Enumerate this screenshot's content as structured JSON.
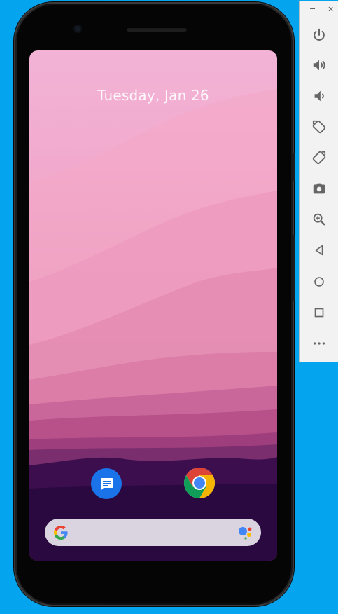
{
  "lockscreen": {
    "date": "Tuesday, Jan 26"
  },
  "home": {
    "apps": [
      {
        "name": "Messages",
        "icon": "messages-icon"
      },
      {
        "name": "Chrome",
        "icon": "chrome-icon"
      }
    ],
    "search_bar": {
      "icon_left": "google-g-icon",
      "icon_right": "assistant-icon"
    }
  },
  "emulator_toolbar": {
    "window_controls": {
      "minimize": "−",
      "close": "×"
    },
    "tools": [
      "power-icon",
      "volume-up-icon",
      "volume-down-icon",
      "rotate-left-icon",
      "rotate-right-icon",
      "screenshot-icon",
      "zoom-icon",
      "back-icon",
      "home-icon",
      "overview-icon",
      "more-icon"
    ]
  },
  "colors": {
    "background": "#04a4ef",
    "toolbar_icon": "#666666",
    "messages_blue": "#1a73e8"
  }
}
